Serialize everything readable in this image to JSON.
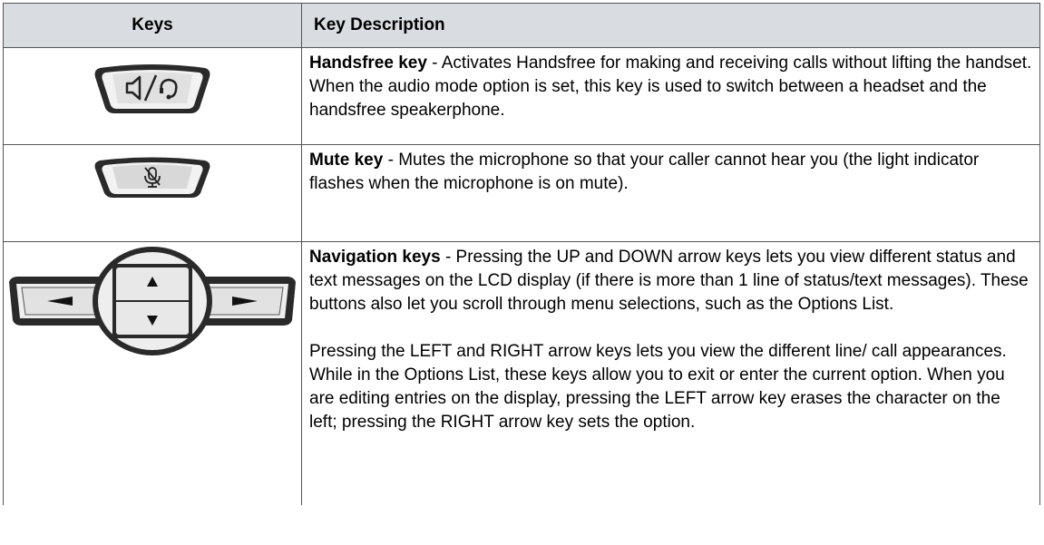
{
  "table": {
    "headers": {
      "keys": "Keys",
      "description": "Key Description"
    },
    "rows": [
      {
        "icon": "handsfree-key-icon",
        "term": "Handsfree key",
        "text": " - Activates Handsfree for making and receiving calls without lifting the handset. When the audio mode option is set, this key is used to switch between a headset and the handsfree speakerphone."
      },
      {
        "icon": "mute-key-icon",
        "term": "Mute key",
        "text": " - Mutes the microphone so that your caller cannot hear you (the light indicator flashes when the microphone is on mute)."
      },
      {
        "icon": "navigation-keys-icon",
        "term": "Navigation keys",
        "text": " - Pressing the UP and DOWN arrow keys lets you view different status and text messages on the LCD display (if there is more than 1 line of status/text messages). These buttons also let you scroll through menu selections, such as the Options List.",
        "text2": "Pressing the LEFT and RIGHT arrow keys lets you view the different line/ call appearances. While in the Options List, these keys allow you to exit or enter the current option. When you are editing entries on the display, pressing the LEFT arrow key erases the character on the left; pressing the RIGHT arrow key sets the option."
      }
    ]
  }
}
